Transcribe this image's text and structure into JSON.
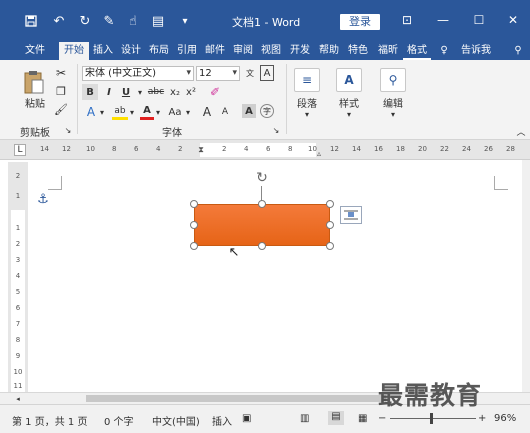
{
  "titlebar": {
    "save_icon": "save-icon",
    "undo_icon": "undo-icon",
    "redo_icon": "redo-icon",
    "title": "文档1 - Word",
    "login": "登录"
  },
  "tabs": [
    "文件",
    "开始",
    "插入",
    "设计",
    "布局",
    "引用",
    "邮件",
    "审阅",
    "视图",
    "开发",
    "帮助",
    "特色",
    "福昕",
    "格式",
    "告诉我"
  ],
  "ribbon": {
    "paste": "粘贴",
    "clipboard": "剪贴板",
    "font_name": "宋体 (中文正文)",
    "font_size": "12",
    "font_group": "字体",
    "bold": "B",
    "italic": "I",
    "underline": "U",
    "strike": "abc",
    "sub": "x₂",
    "sup": "x²",
    "clear": "Aa",
    "grow": "A",
    "shrink": "A",
    "paragraph": "段落",
    "styles": "样式",
    "editing": "编辑"
  },
  "ruler": {
    "labels": [
      "14",
      "12",
      "10",
      "8",
      "6",
      "4",
      "2",
      "2",
      "4",
      "6",
      "8",
      "10",
      "12",
      "14",
      "16",
      "18",
      "20",
      "22",
      "24",
      "26",
      "28"
    ]
  },
  "vruler": {
    "labels": [
      "2",
      "1",
      "1",
      "2",
      "3",
      "4",
      "5",
      "6",
      "7",
      "8",
      "9",
      "10",
      "11"
    ]
  },
  "status": {
    "page": "第 1 页，共 1 页",
    "words": "0 个字",
    "lang": "中文(中国)",
    "insert": "插入",
    "zoom": "96%"
  },
  "watermark": "最需教育",
  "colors": {
    "accent": "#2b579a",
    "shape": "#ef6c24"
  }
}
